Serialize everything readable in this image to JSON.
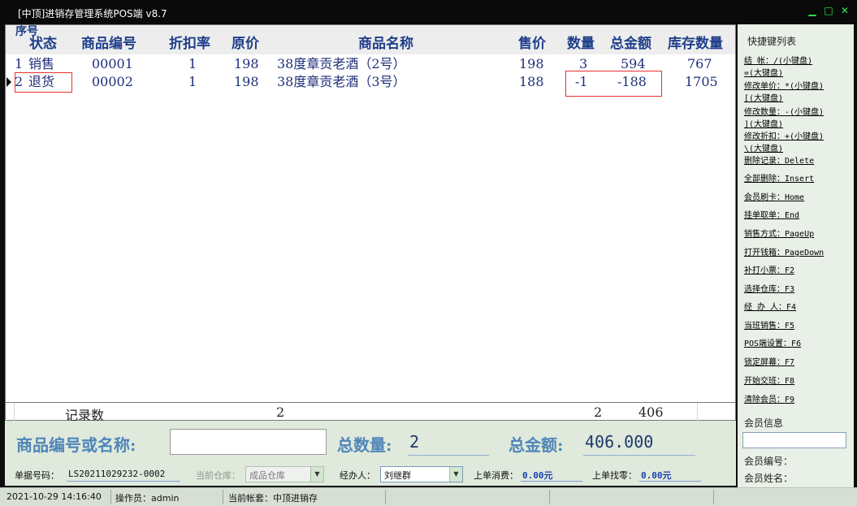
{
  "window": {
    "title": "[中顶]进销存管理系统POS端 v8.7",
    "buttons": [
      "▁",
      "□",
      "✕"
    ]
  },
  "grid": {
    "columns": {
      "seq": "序号",
      "status": "状态",
      "code": "商品编号",
      "discount": "折扣率",
      "orig_price": "原价",
      "name": "商品名称",
      "price": "售价",
      "qty": "数量",
      "amount": "总金额",
      "stock": "库存数量"
    },
    "rows": [
      {
        "seq": "1",
        "status": "销售",
        "code": "00001",
        "discount": "1",
        "orig_price": "198",
        "name": "38度章贡老酒（2号）",
        "price": "198",
        "qty": "3",
        "amount": "594",
        "stock": "767"
      },
      {
        "seq": "2",
        "status": "退货",
        "code": "00002",
        "discount": "1",
        "orig_price": "198",
        "name": "38度章贡老酒（3号）",
        "price": "188",
        "qty": "-1",
        "amount": "-188",
        "stock": "1705"
      }
    ],
    "footer": {
      "label": "记录数",
      "count": "2",
      "qty_total": "2",
      "amount_total": "406"
    }
  },
  "shortcuts": {
    "title": "快捷键列表",
    "items": [
      "结    帐：/(小键盘)",
      "        =(大键盘)",
      "修改单价：*(小键盘)",
      "        [(大键盘)",
      "修改数量：-(小键盘)",
      "        ](大键盘)",
      "修改折扣：+(小键盘)",
      "        \\(大键盘)",
      "删除记录：Delete",
      "全部删除：Insert",
      "会员刷卡：Home",
      "挂单取单：End",
      "销售方式：PageUp",
      "打开钱箱：PageDown",
      "补打小票：F2",
      "选择仓库：F3",
      "经 办 人：F4",
      "当班销售：F5",
      "POS端设置：F6",
      "锁定屏幕：F7",
      "开始交班：F8",
      "清除会员：F9"
    ]
  },
  "member": {
    "title": "会员信息",
    "card_value": "",
    "no_label": "会员编号：",
    "name_label": "会员姓名："
  },
  "entry": {
    "code_label": "商品编号或名称:",
    "code_value": "",
    "qty_label": "总数量:",
    "qty_value": "2",
    "amount_label": "总金额:",
    "amount_value": "406.000"
  },
  "info": {
    "order_no_label": "单据号码：",
    "order_no": "LS20211029232-0002",
    "warehouse_label": "当前仓库：",
    "warehouse": "成品仓库",
    "handler_label": "经办人：",
    "handler": "刘继群",
    "last_spend_label": "上单消费：",
    "last_spend": "0.00元",
    "last_change_label": "上单找零：",
    "last_change": "0.00元"
  },
  "status": {
    "datetime": "2021-10-29 14:16:40",
    "operator": "操作员：admin",
    "account": "当前帐套：中顶进销存"
  }
}
